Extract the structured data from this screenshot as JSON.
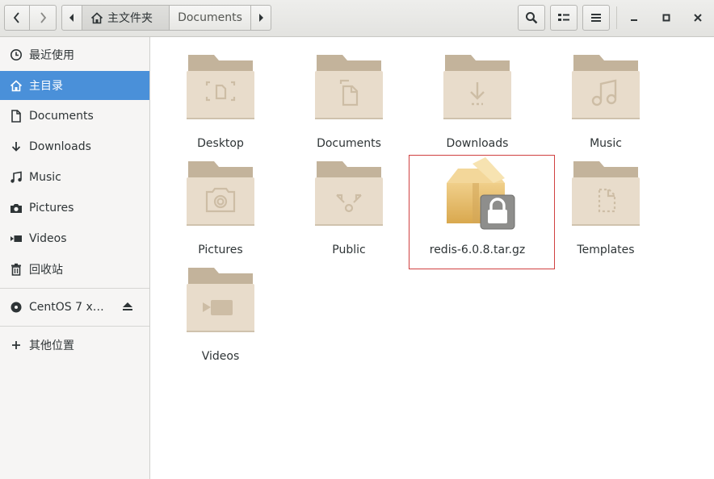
{
  "header": {
    "back_icon": "chevron-left-icon",
    "forward_icon": "chevron-right-icon",
    "path_left_icon": "chevron-left-icon",
    "path_right_icon": "chevron-right-icon",
    "breadcrumb": [
      {
        "label": "主文件夹",
        "icon": "home-icon"
      },
      {
        "label": "Documents"
      }
    ],
    "search_icon": "search-icon",
    "view_icon": "list-view-icon",
    "menu_icon": "hamburger-menu-icon"
  },
  "sidebar": {
    "items": [
      {
        "label": "最近使用",
        "icon": "clock-icon"
      },
      {
        "label": "主目录",
        "icon": "home-icon",
        "active": true
      },
      {
        "label": "Documents",
        "icon": "document-icon"
      },
      {
        "label": "Downloads",
        "icon": "download-icon"
      },
      {
        "label": "Music",
        "icon": "music-note-icon"
      },
      {
        "label": "Pictures",
        "icon": "camera-icon"
      },
      {
        "label": "Videos",
        "icon": "video-icon"
      },
      {
        "label": "回收站",
        "icon": "trash-icon"
      }
    ],
    "devices": [
      {
        "label": "CentOS 7 x…",
        "icon": "disc-icon",
        "eject_icon": "eject-icon"
      }
    ],
    "other": {
      "label": "其他位置",
      "icon": "plus-icon"
    }
  },
  "files": [
    {
      "name": "Desktop",
      "emblem": "desktop-icon"
    },
    {
      "name": "Documents",
      "emblem": "document-icon"
    },
    {
      "name": "Downloads",
      "emblem": "download-icon"
    },
    {
      "name": "Music",
      "emblem": "music-note-icon"
    },
    {
      "name": "Pictures",
      "emblem": "camera-icon"
    },
    {
      "name": "Public",
      "emblem": "share-icon"
    },
    {
      "name": "redis-6.0.8.tar.gz",
      "emblem": "archive-icon",
      "locked": true,
      "selected": true
    },
    {
      "name": "Templates",
      "emblem": "template-icon"
    },
    {
      "name": "Videos",
      "emblem": "video-icon"
    }
  ],
  "colors": {
    "accent": "#4a90d9",
    "folder_light": "#e8dccb",
    "folder_dark": "#c3b39b",
    "selection_border": "#d04040"
  }
}
